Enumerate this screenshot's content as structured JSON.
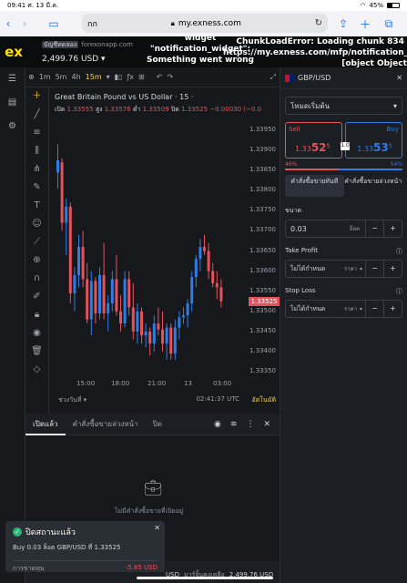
{
  "ios": {
    "time": "09:41",
    "date": "ศ. 13 มี.ค.",
    "battery": "45%"
  },
  "safari": {
    "reader": "กก",
    "url": "my.exness.com"
  },
  "topbar": {
    "account_tag": "บัญชีทดลอง",
    "server": "forexonapp.com",
    "balance": "2,499.76 USD",
    "error_widget": "widget \"notification_widget\": Something went wrong",
    "error_chunk_1": "ChunkLoadError: Loading chunk 834 f",
    "error_chunk_2": "https://my.exness.com/mfp/notification_widget/",
    "error_chunk_3": "[object Object]"
  },
  "chart": {
    "timeframes": [
      "1m",
      "5m",
      "4h",
      "15m"
    ],
    "active_timeframe": "15m",
    "symbol_title": "Great Britain Pound vs US Dollar · 15 ·",
    "ohlc": {
      "o_label": "เปิด",
      "o": "1.33555",
      "h_label": "สูง",
      "h": "1.33576",
      "l_label": "ต่ำ",
      "l": "1.33509",
      "c_label": "ปิด",
      "c": "1.33525",
      "chg": "−0.00030 (−0.0"
    },
    "y_ticks": [
      "1.33950",
      "1.33900",
      "1.33850",
      "1.33800",
      "1.33750",
      "1.33700",
      "1.33650",
      "1.33600",
      "1.33550",
      "1.33500",
      "1.33450",
      "1.33400",
      "1.33350"
    ],
    "last_price": "1.33525",
    "x_ticks": [
      "15:00",
      "18:00",
      "21:00",
      "13",
      "03:00"
    ],
    "range_label": "ช่วงวันที่",
    "clock": "02:41:37 UTC",
    "auto_label": "อัตโนมัติ",
    "ylim": [
      1.3333,
      1.3397
    ],
    "candles": [
      [
        1.33845,
        1.33915,
        1.33805,
        1.33875
      ],
      [
        1.3387,
        1.3388,
        1.337,
        1.3372
      ],
      [
        1.3372,
        1.3378,
        1.3364,
        1.3376
      ],
      [
        1.3376,
        1.3377,
        1.3352,
        1.33545
      ],
      [
        1.33545,
        1.3361,
        1.335,
        1.3359
      ],
      [
        1.3359,
        1.3369,
        1.3356,
        1.3366
      ],
      [
        1.3366,
        1.337,
        1.3356,
        1.3358
      ],
      [
        1.3358,
        1.3362,
        1.3347,
        1.3348
      ],
      [
        1.3348,
        1.336,
        1.3344,
        1.33575
      ],
      [
        1.33575,
        1.33585,
        1.3347,
        1.33495
      ],
      [
        1.33495,
        1.3361,
        1.3348,
        1.3359
      ],
      [
        1.3359,
        1.3367,
        1.3348,
        1.33495
      ],
      [
        1.33495,
        1.3354,
        1.3345,
        1.3352
      ],
      [
        1.3352,
        1.336,
        1.335,
        1.3358
      ],
      [
        1.3358,
        1.3364,
        1.3349,
        1.335
      ],
      [
        1.335,
        1.3354,
        1.3345,
        1.3347
      ],
      [
        1.3347,
        1.336,
        1.3346,
        1.3358
      ],
      [
        1.3358,
        1.336,
        1.3349,
        1.3351
      ],
      [
        1.3351,
        1.3357,
        1.3343,
        1.3345
      ],
      [
        1.3345,
        1.3352,
        1.3342,
        1.335
      ],
      [
        1.335,
        1.3351,
        1.3342,
        1.3344
      ],
      [
        1.3344,
        1.3347,
        1.3341,
        1.3345
      ],
      [
        1.3345,
        1.3346,
        1.3339,
        1.3342
      ],
      [
        1.3342,
        1.3349,
        1.334,
        1.3347
      ],
      [
        1.3347,
        1.3351,
        1.3344,
        1.33455
      ],
      [
        1.33455,
        1.335,
        1.334,
        1.3342
      ],
      [
        1.3342,
        1.3347,
        1.3338,
        1.3346
      ],
      [
        1.3346,
        1.3347,
        1.3338,
        1.33395
      ],
      [
        1.33395,
        1.3348,
        1.3338,
        1.3346
      ],
      [
        1.3346,
        1.335,
        1.3343,
        1.33485
      ],
      [
        1.33485,
        1.3351,
        1.3347,
        1.3349
      ],
      [
        1.3349,
        1.3353,
        1.3346,
        1.3352
      ],
      [
        1.3352,
        1.336,
        1.335,
        1.33585
      ],
      [
        1.33585,
        1.3364,
        1.3356,
        1.3363
      ],
      [
        1.3363,
        1.3368,
        1.336,
        1.3366
      ],
      [
        1.3366,
        1.3369,
        1.3364,
        1.3365
      ],
      [
        1.3365,
        1.3367,
        1.3358,
        1.336
      ],
      [
        1.336,
        1.3362,
        1.3356,
        1.3357
      ],
      [
        1.3357,
        1.336,
        1.3353,
        1.3356
      ],
      [
        1.3356,
        1.3358,
        1.3351,
        1.33525
      ]
    ]
  },
  "trade": {
    "symbol": "GBP/USD",
    "mode": "โหมดเริ่มต้น",
    "sell_label": "Sell",
    "sell_price_small": "1.33",
    "sell_price_big": "52",
    "sell_price_sup": "5",
    "buy_label": "Buy",
    "buy_price_small": "1.33",
    "buy_price_big": "53",
    "buy_price_sup": "5",
    "spread": "1.0",
    "sell_pct": "46%",
    "buy_pct": "54%",
    "order_market": "คำสั่งซื้อขายทันที",
    "order_pending": "คำสั่งซื้อขายล่วงหน้า",
    "size_label": "ขนาด",
    "size_value": "0.03",
    "size_unit": "ล็อต",
    "tp_label": "Take Profit",
    "tp_value": "ไม่ได้กำหนด",
    "tp_unit": "ราคา",
    "sl_label": "Stop Loss",
    "sl_value": "ไม่ได้กำหนด",
    "sl_unit": "ราคา"
  },
  "bottom_tabs": {
    "open": "เปิดแล้ว",
    "pending": "คำสั่งซื้อขายล่วงหน้า",
    "closed": "ปิด"
  },
  "empty": {
    "message": "ไม่มีคำสั่งซื้อขายที่เปิดอยู่"
  },
  "toast": {
    "title": "ปิดสถานะแล้ว",
    "detail": "Buy 0.03 ล็อต GBP/USD ที่ 1.33525",
    "pl_label": "การขาดทุน",
    "pl_value": "-5.85 USD"
  },
  "footer": {
    "currency": "USD",
    "equity_label": "มาร์จิ้นคงเหลือ",
    "equity": "2,499.76 USD"
  },
  "colors": {
    "bull": "#2e7de6",
    "bear": "#e4535b",
    "accent": "#f5d142"
  }
}
